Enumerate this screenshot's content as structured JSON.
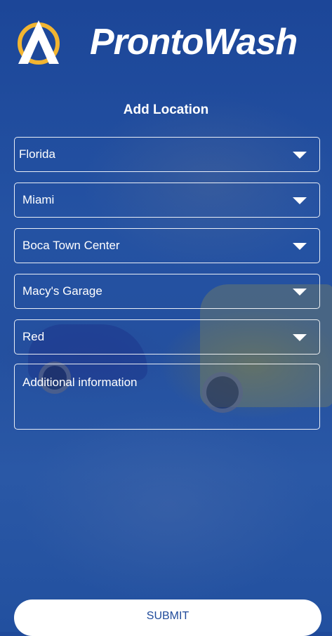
{
  "header": {
    "brand_name": "ProntoWash",
    "logo_icon": "pronto-a-logo-icon"
  },
  "form": {
    "title": "Add Location",
    "fields": [
      {
        "label": "Florida",
        "icon": "chevron-down-icon"
      },
      {
        "label": "Miami",
        "icon": "chevron-down-icon"
      },
      {
        "label": "Boca Town Center",
        "icon": "chevron-down-icon"
      },
      {
        "label": "Macy's Garage",
        "icon": "chevron-down-icon"
      },
      {
        "label": "Red",
        "icon": "chevron-down-icon"
      }
    ],
    "additional_info_placeholder": "Additional information",
    "submit_label": "SUBMIT"
  },
  "colors": {
    "background": "#1f4a9a",
    "logo_accent": "#f2b531",
    "text": "#ffffff"
  }
}
